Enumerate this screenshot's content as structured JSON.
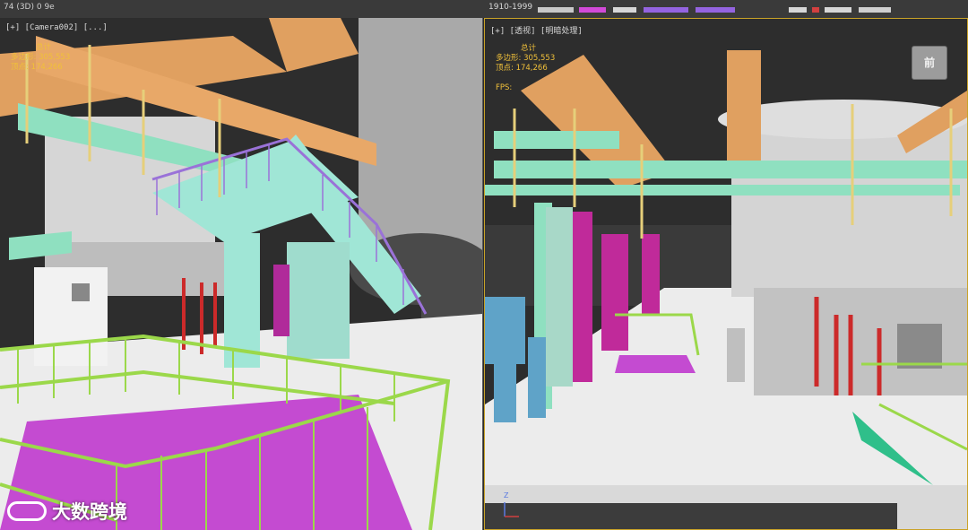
{
  "titlebar": {
    "left_text": "74 (3D) 0 9e",
    "right_text": "1910-1999"
  },
  "viewports": {
    "left": {
      "label": "[+] [Camera002] [...]",
      "stats_title": "总计",
      "polygons_label": "多边形:",
      "polygons_value": "305,553",
      "vertices_label": "顶点:",
      "vertices_value": "174,266"
    },
    "right": {
      "label": "[+] [透视] [明暗处理]",
      "stats_title": "总计",
      "polygons_label": "多边形:",
      "polygons_value": "305,553",
      "vertices_label": "顶点:",
      "vertices_value": "174,266",
      "fps_label": "FPS:",
      "viewcube_label": "前",
      "axis_label": "Z"
    }
  },
  "watermark": {
    "text": "大数跨境",
    "logo_icon": "brand-logo-icon"
  },
  "colors": {
    "pipe_green": "#8fe0c0",
    "rail_green": "#9bd84a",
    "floor_magenta": "#c44bd1",
    "beam_orange": "#e0a060",
    "stair_purple": "#9a72d8",
    "stats_yellow": "#f0c03a",
    "active_border": "#c9a227"
  }
}
